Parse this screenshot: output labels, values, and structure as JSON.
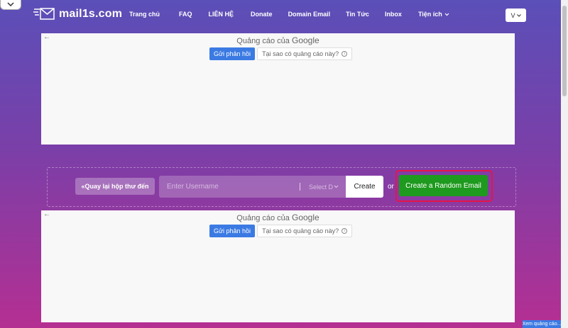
{
  "site": {
    "name": "mail1s.com"
  },
  "nav": {
    "items": [
      {
        "label": "Trang chủ"
      },
      {
        "label": "FAQ"
      },
      {
        "label": "LIÊN HỆ"
      },
      {
        "label": "Donate"
      },
      {
        "label": "Domain Email"
      },
      {
        "label": "Tin Tức"
      },
      {
        "label": "Inbox"
      },
      {
        "label": "Tiện ích"
      }
    ],
    "language": "V"
  },
  "ads": {
    "top": {
      "title": "Quảng cáo của",
      "brand": "Google",
      "feedback": "Gửi phản hồi",
      "why": "Tại sao có quảng cáo này?"
    },
    "bottom": {
      "title": "Quảng cáo của",
      "brand": "Google",
      "feedback": "Gửi phản hồi",
      "why": "Tại sao có quảng cáo này?"
    }
  },
  "form": {
    "back_label": "«Quay lại hộp thư đến",
    "username_placeholder": "Enter Username",
    "domain_placeholder": "Select D",
    "create_label": "Create",
    "or_label": "or",
    "random_label": "Create a Random Email"
  },
  "footer": {
    "view_ads": "Xem quảng cáo..."
  },
  "colors": {
    "gradient_top": "#5b4fb8",
    "gradient_bottom": "#b52f92",
    "random_button": "#1e9a1e",
    "highlight": "#e5154a",
    "feedback_button": "#3b7ae3"
  }
}
